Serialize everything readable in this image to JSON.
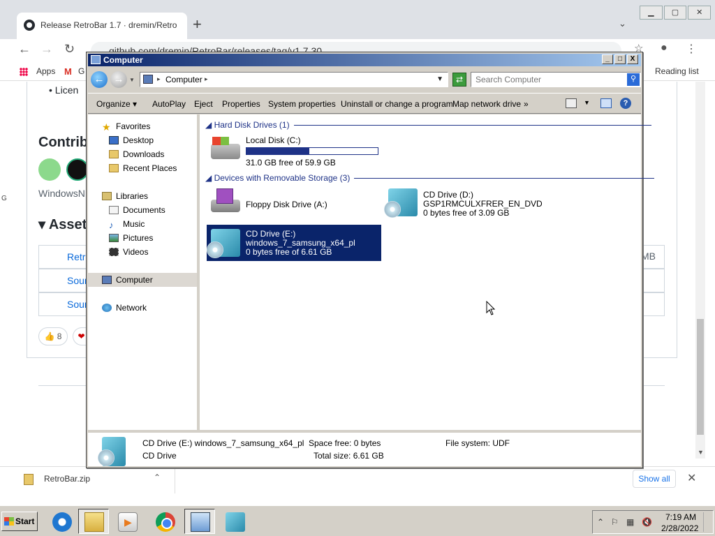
{
  "chrome": {
    "tab_title": "Release RetroBar 1.7 · dremin/Retro",
    "new_tab": "+",
    "url": "github.com/dremin/RetroBar/releases/tag/v1.7.30",
    "bookmarks": {
      "apps": "Apps",
      "gmail_partial": "G",
      "reading_list": "Reading list"
    },
    "window_buttons": [
      "▁",
      "▢",
      "✕"
    ]
  },
  "github": {
    "license_partial": "• Licen",
    "contributors_partial": "Contrib",
    "windowsn_partial": "WindowsN",
    "assets_partial": "▾ Assets",
    "asset_rows": [
      "Retro",
      "Sour",
      "Sour"
    ],
    "asset_size_partial": "MB",
    "reaction_thumbs": "👍 8",
    "reaction_heart": "❤",
    "side_letter": "G"
  },
  "download": {
    "file": "RetroBar.zip",
    "show_all": "Show all",
    "close": "✕"
  },
  "explorer": {
    "title": "Computer",
    "address": "Computer",
    "search_placeholder": "Search Computer",
    "window_buttons": [
      "_",
      "□",
      "X"
    ],
    "commands": [
      "Organize ▾",
      "AutoPlay",
      "Eject",
      "Properties",
      "System properties",
      "Uninstall or change a program",
      "Map network drive",
      "»"
    ],
    "nav": {
      "favorites": "Favorites",
      "desktop": "Desktop",
      "downloads": "Downloads",
      "recent": "Recent Places",
      "libraries": "Libraries",
      "documents": "Documents",
      "music": "Music",
      "pictures": "Pictures",
      "videos": "Videos",
      "computer": "Computer",
      "network": "Network"
    },
    "groups": {
      "hdd": "◢ Hard Disk Drives (1)",
      "removable": "◢ Devices with Removable Storage (3)"
    },
    "drives": {
      "c": {
        "name": "Local Disk (C:)",
        "free": "31.0 GB free of 59.9 GB",
        "used_fraction": 0.48
      },
      "a": {
        "name": "Floppy Disk Drive (A:)"
      },
      "d": {
        "name": "CD Drive (D:)",
        "label": "GSP1RMCULXFRER_EN_DVD",
        "free": "0 bytes free of 3.09 GB"
      },
      "e": {
        "name": "CD Drive (E:)",
        "label": "windows_7_samsung_x64_pl",
        "free": "0 bytes free of 6.61 GB"
      }
    },
    "details": {
      "name": "CD Drive (E:) windows_7_samsung_x64_pl",
      "type": "CD Drive",
      "space_free": "Space free: 0 bytes",
      "total_size": "Total size: 6.61 GB",
      "file_system": "File system: UDF"
    }
  },
  "taskbar": {
    "start": "Start",
    "time": "7:19 AM",
    "date": "2/28/2022"
  }
}
